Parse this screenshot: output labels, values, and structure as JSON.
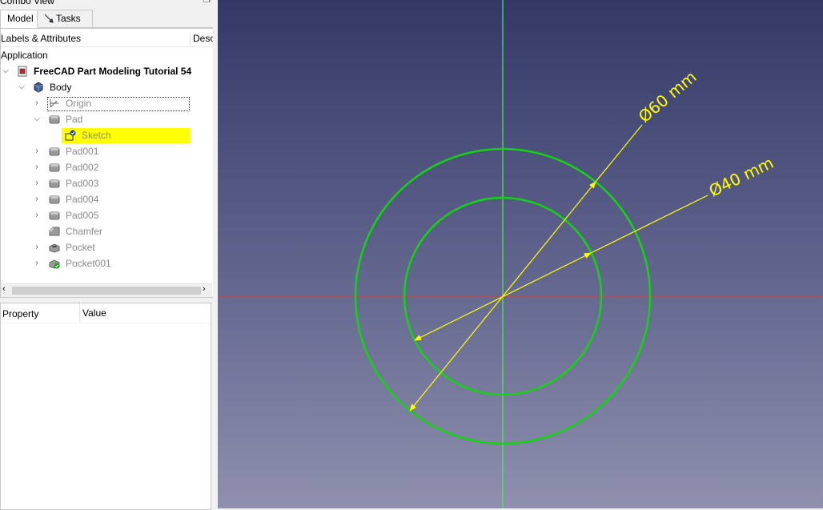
{
  "combo": {
    "title": "Combo View",
    "tabs": [
      "Model",
      "Tasks"
    ],
    "tree_headers": [
      "Labels & Attributes",
      "Desc"
    ],
    "root_label": "Application",
    "document": "FreeCAD Part Modeling Tutorial 54",
    "body": "Body",
    "items": {
      "origin": "Origin",
      "pad": "Pad",
      "sketch": "Sketch",
      "pad001": "Pad001",
      "pad002": "Pad002",
      "pad003": "Pad003",
      "pad004": "Pad004",
      "pad005": "Pad005",
      "chamfer": "Chamfer",
      "pocket": "Pocket",
      "pocket001": "Pocket001"
    },
    "property_headers": [
      "Property",
      "Value"
    ]
  },
  "viewport": {
    "dimensions": [
      "Ø60 mm",
      "Ø40 mm"
    ],
    "colors": {
      "circle": "#14d214",
      "dimension": "#ffff00",
      "x_axis": "#dc3c3c",
      "y_axis": "#4cf04c",
      "background_top": "#333867",
      "background_bottom": "#8e90ad"
    }
  }
}
